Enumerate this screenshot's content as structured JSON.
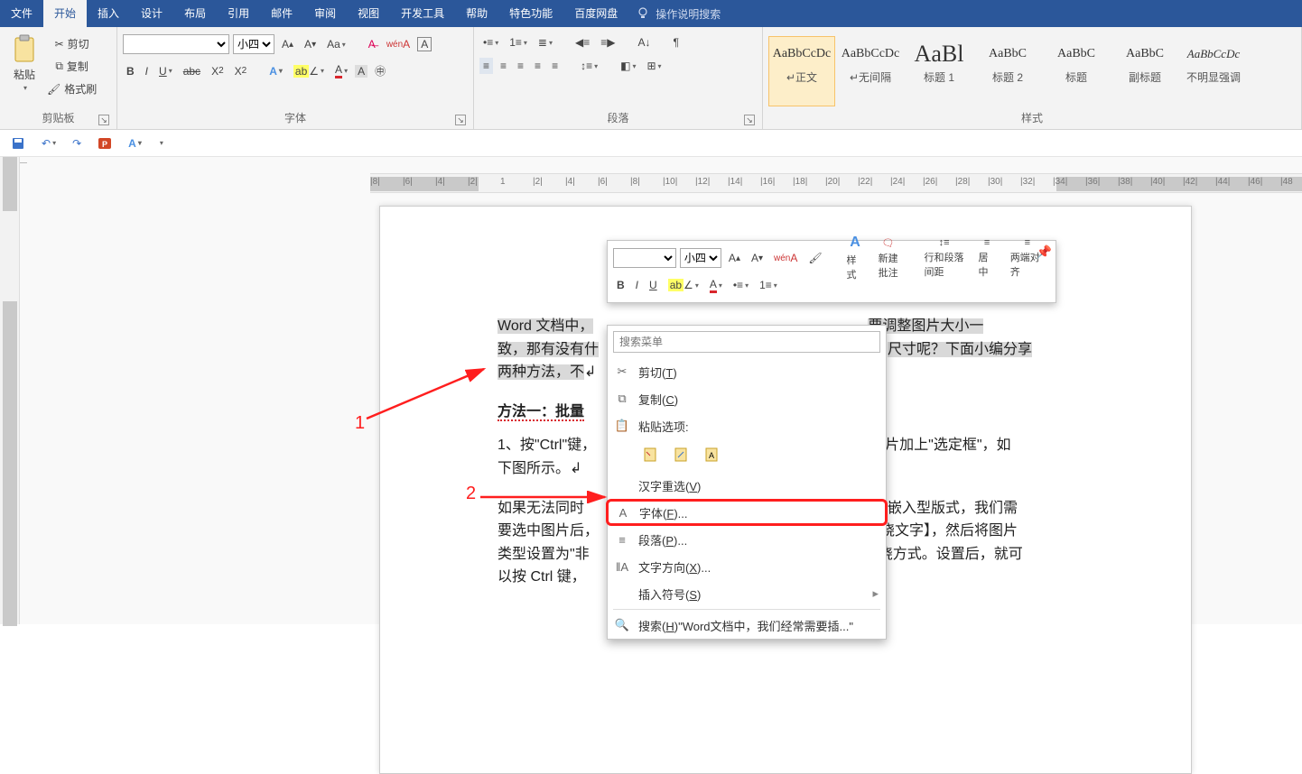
{
  "tabs": {
    "file": "文件",
    "home": "开始",
    "insert": "插入",
    "design": "设计",
    "layout": "布局",
    "references": "引用",
    "mail": "邮件",
    "review": "审阅",
    "view": "视图",
    "dev": "开发工具",
    "help": "帮助",
    "special": "特色功能",
    "baidu": "百度网盘",
    "tellme": "操作说明搜索"
  },
  "clipboard": {
    "paste": "粘贴",
    "cut": "剪切",
    "copy": "复制",
    "format_painter": "格式刷",
    "group": "剪贴板"
  },
  "font": {
    "group": "字体",
    "size": "小四"
  },
  "paragraph": {
    "group": "段落"
  },
  "styles": {
    "group": "样式",
    "items": [
      {
        "preview": "AaBbCcDc",
        "name": "↵正文"
      },
      {
        "preview": "AaBbCcDc",
        "name": "↵无间隔"
      },
      {
        "preview": "AaBl",
        "name": "标题 1",
        "big": true
      },
      {
        "preview": "AaBbC",
        "name": "标题 2"
      },
      {
        "preview": "AaBbC",
        "name": "标题"
      },
      {
        "preview": "AaBbC",
        "name": "副标题"
      },
      {
        "preview": "AaBbCcDc",
        "name": "不明显强调",
        "italic": true
      }
    ]
  },
  "doc": {
    "p1_a": "Word 文档中，",
    "p1_b": "要调整图片大小一",
    "p2_a": "致，那有没有什",
    "p2_b": "尺寸呢？下面小编分享",
    "p3": "两种方法，不",
    "h1": "方法一：批量",
    "p4_a": "1、按\"Ctrl\"键，",
    "p4_b": "图片加上\"选定框\"，如",
    "p5": "下图所示。",
    "p6_a": "如果无法同时",
    "p6_b": "为嵌入型版式，我们需",
    "p7_a": "要选中图片后，",
    "p7_b": "绕文字】，然后将图片",
    "p8_a": "类型设置为\"非",
    "p8_b": "绕方式。设置后，就可",
    "p9": "以按 Ctrl 键，"
  },
  "mini": {
    "size": "小四",
    "style": "样式",
    "new_comment": "新建\n批注",
    "spacing": "行和段落\n间距",
    "center": "居中",
    "justify": "两端对齐"
  },
  "context": {
    "search_placeholder": "搜索菜单",
    "cut": "剪切",
    "cut_k": "T",
    "copy": "复制",
    "copy_k": "C",
    "paste_options": "粘贴选项:",
    "hanzi": "汉字重选",
    "hanzi_k": "V",
    "font": "字体",
    "font_k": "F",
    "paragraph": "段落",
    "paragraph_k": "P",
    "text_dir": "文字方向",
    "text_dir_k": "X",
    "symbol": "插入符号",
    "symbol_k": "S",
    "search": "搜索",
    "search_k": "H",
    "search_tail": "\"Word文档中，我们经常需要插...\""
  },
  "anno": {
    "one": "1",
    "two": "2"
  },
  "ruler_h": [
    "|8|",
    "|6|",
    "|4|",
    "|2|",
    "1",
    "|2|",
    "|4|",
    "|6|",
    "|8|",
    "|10|",
    "|12|",
    "|14|",
    "|16|",
    "|18|",
    "|20|",
    "|22|",
    "|24|",
    "|26|",
    "|28|",
    "|30|",
    "|32|",
    "|34|",
    "|36|",
    "|38|",
    "|40|",
    "|42|",
    "|44|",
    "|46|",
    "|48"
  ]
}
